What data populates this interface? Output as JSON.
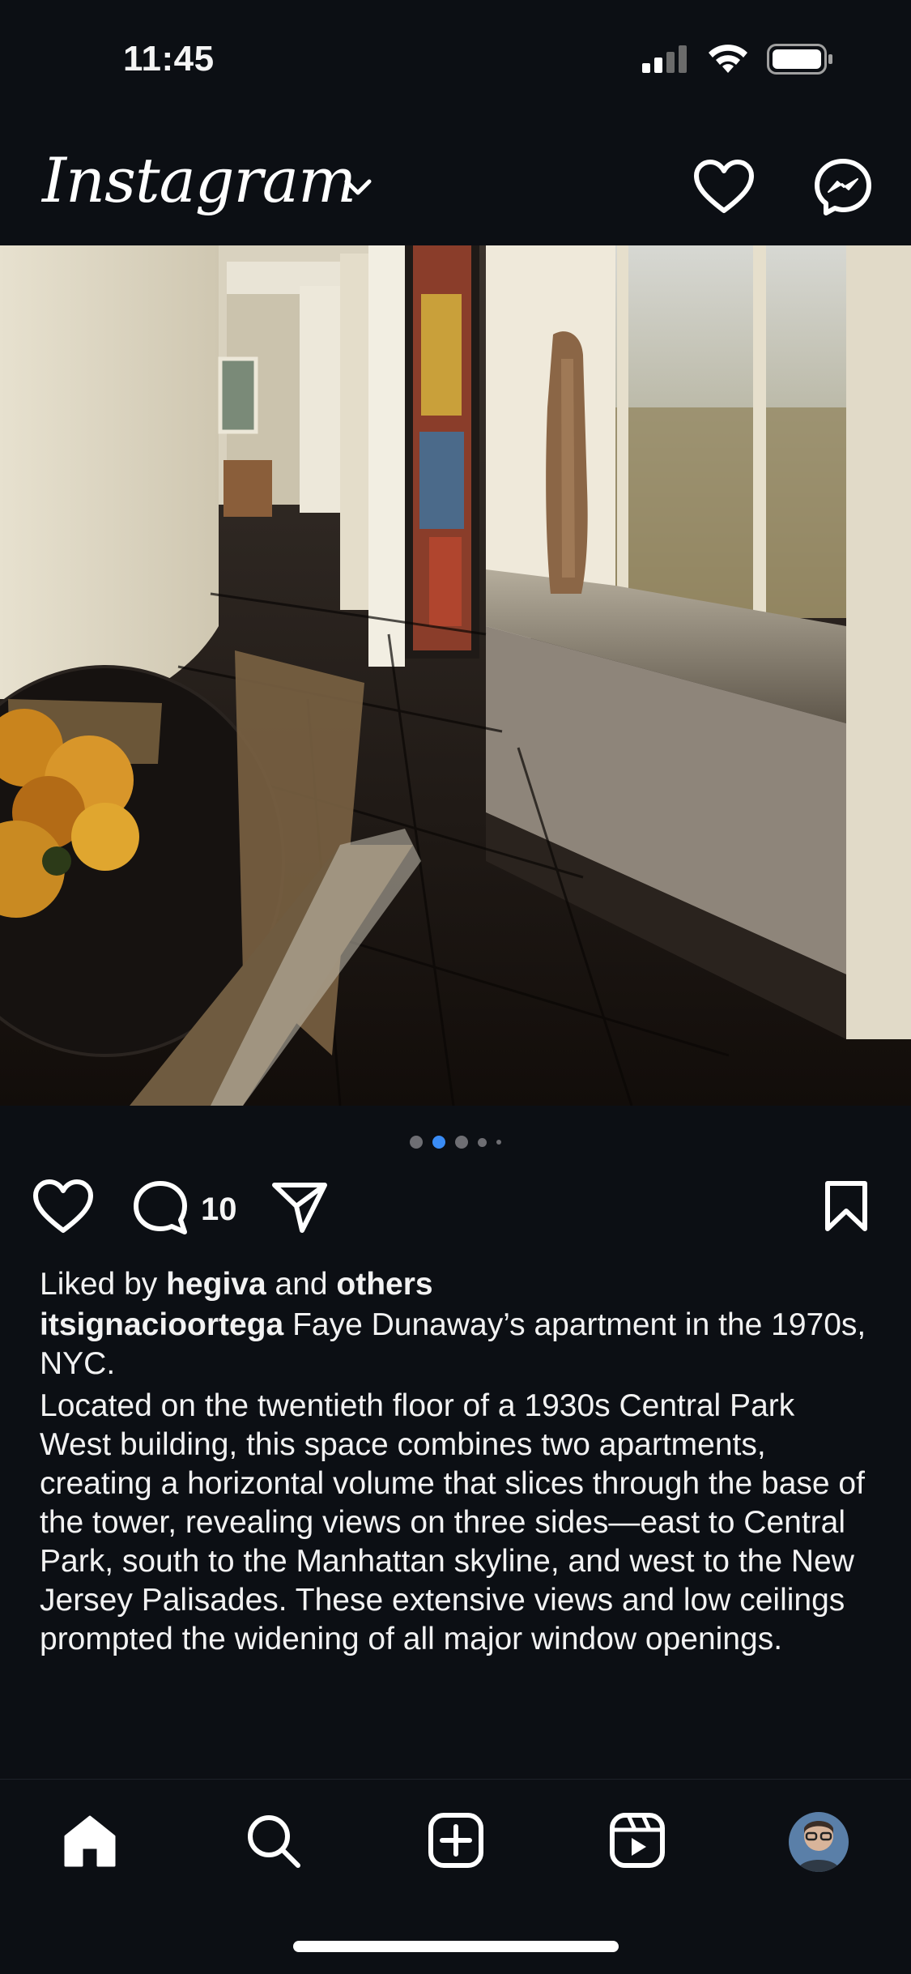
{
  "status": {
    "time": "11:45"
  },
  "header": {
    "logo_text": "Instagram",
    "icons": [
      "chevron-down-icon",
      "heart-icon",
      "messenger-icon"
    ]
  },
  "post": {
    "carousel": {
      "count": 5,
      "active_index": 1
    },
    "comment_count": "10",
    "likes": {
      "prefix": "Liked by ",
      "user": "hegiva",
      "joiner": " and ",
      "others": "others"
    },
    "caption": {
      "username": "itsignacioortega",
      "first_line": " Faye Dunaway’s apartment in the 1970s, NYC.",
      "body": "Located on the twentieth floor of a 1930s Central Park West building, this space combines two apartments, creating a horizontal volume that slices through the base of the tower, revealing views on three sides—east to Central Park, south to the Manhattan skyline, and west to the New Jersey Palisades. These extensive views and low ceilings prompted the widening of all major window openings."
    }
  },
  "tab_bar": {
    "items": [
      "home-icon",
      "search-icon",
      "create-icon",
      "reels-icon",
      "profile-avatar"
    ]
  },
  "colors": {
    "background": "#0c0f14",
    "active_dot": "#3a8cf5",
    "text": "#f5f5f5"
  }
}
